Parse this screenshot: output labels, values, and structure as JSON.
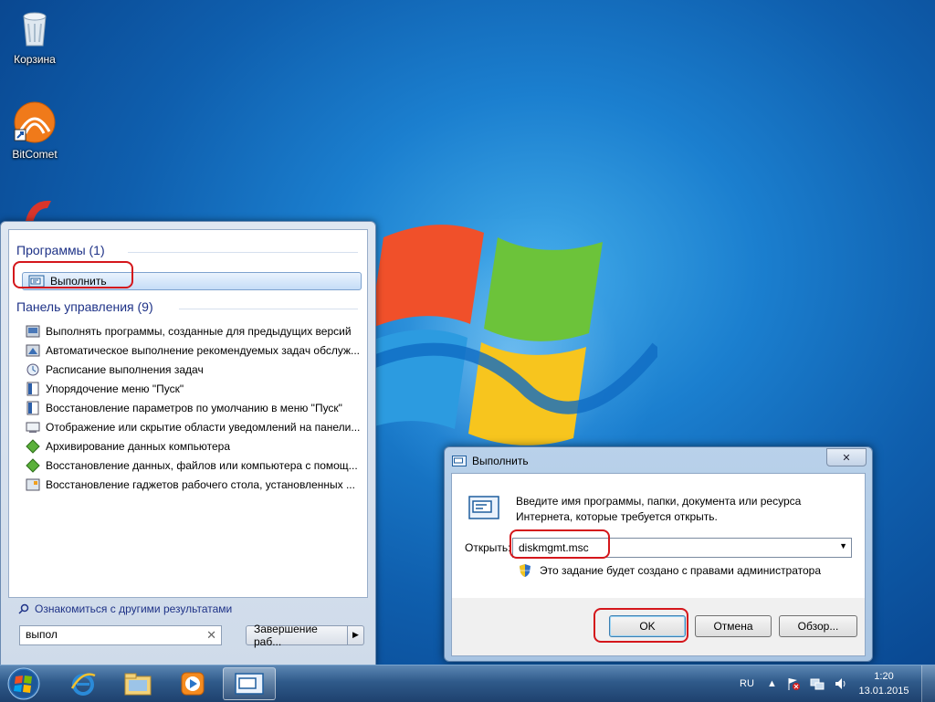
{
  "desktop": {
    "icons": [
      {
        "label": "Корзина",
        "icon": "recycle-bin-icon"
      },
      {
        "label": "BitComet",
        "icon": "bitcomet-icon"
      },
      {
        "label": "",
        "icon": "ccleaner-icon"
      }
    ]
  },
  "start_menu": {
    "programs_group": "Программы (1)",
    "run_item": "Выполнить",
    "control_panel_group": "Панель управления (9)",
    "control_panel_items": [
      "Выполнять программы, созданные для предыдущих версий",
      "Автоматическое выполнение рекомендуемых задач обслуж...",
      "Расписание выполнения задач",
      "Упорядочение меню \"Пуск\"",
      "Восстановление параметров по умолчанию в меню \"Пуск\"",
      "Отображение или скрытие области уведомлений на панели...",
      "Архивирование данных компьютера",
      "Восстановление данных, файлов или компьютера с помощ...",
      "Восстановление гаджетов рабочего стола, установленных ..."
    ],
    "more_results": "Ознакомиться с другими результатами",
    "search_value": "выпол",
    "shutdown_label": "Завершение раб..."
  },
  "run_dialog": {
    "title": "Выполнить",
    "close_glyph": "✕",
    "description": "Введите имя программы, папки, документа или ресурса Интернета, которые требуется открыть.",
    "open_label": "Открыть:",
    "open_value": "diskmgmt.msc",
    "admin_note": "Это задание будет создано с правами администратора",
    "ok_label": "OK",
    "cancel_label": "Отмена",
    "browse_label": "Обзор..."
  },
  "taskbar": {
    "language": "RU",
    "time": "1:20",
    "date": "13.01.2015",
    "pinned": [
      "internet-explorer-icon",
      "explorer-icon",
      "media-player-icon",
      "run-icon"
    ]
  },
  "colors": {
    "accent_red": "#d4161b",
    "group_header_blue": "#1e3287"
  }
}
